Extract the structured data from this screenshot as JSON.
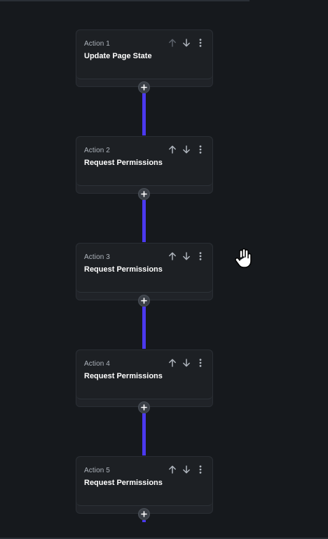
{
  "actions": [
    {
      "label": "Action 1",
      "title": "Update Page State"
    },
    {
      "label": "Action 2",
      "title": "Request Permissions"
    },
    {
      "label": "Action 3",
      "title": "Request Permissions"
    },
    {
      "label": "Action 4",
      "title": "Request Permissions"
    },
    {
      "label": "Action 5",
      "title": "Request Permissions"
    }
  ],
  "colors": {
    "background": "#16191d",
    "card": "#1d2024",
    "connector": "#4b39ef",
    "label": "#aeb4bc",
    "icon": "#aeb4bc",
    "icon_disabled": "#5b616a"
  },
  "icons": [
    "arrow-up-icon",
    "arrow-down-icon",
    "more-vertical-icon",
    "plus-icon",
    "hand-cursor-icon"
  ]
}
